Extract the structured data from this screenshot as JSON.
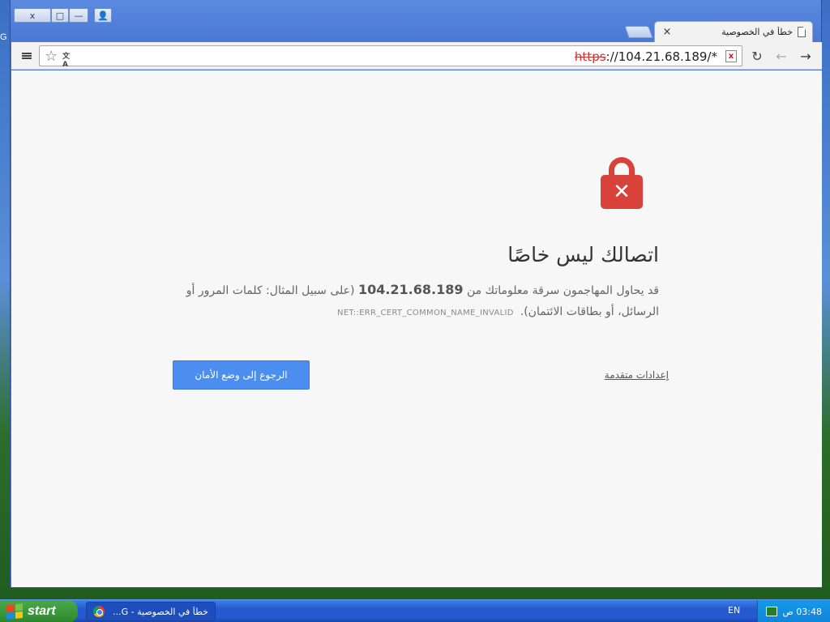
{
  "desktop": {
    "edge_letter": "G"
  },
  "window": {
    "buttons": {
      "close": "x",
      "maximize": "□",
      "minimize": "—",
      "user": "👤"
    }
  },
  "tab": {
    "title": "خطأ في الخصوصية",
    "close": "×"
  },
  "toolbar": {
    "url_scheme": "https",
    "url_rest": "://104.21.68.189/*",
    "cert_icon": "x"
  },
  "interstitial": {
    "heading": "اتصالك ليس خاصًا",
    "body_before": "قد يحاول المهاجمون سرقة معلوماتك من ",
    "host": "104.21.68.189",
    "body_after": " (على سبيل المثال: كلمات المرور أو الرسائل، أو بطاقات الائتمان).",
    "error_code": "NET::ERR_CERT_COMMON_NAME_INVALID",
    "back_button": "الرجوع إلى وضع الأمان",
    "advanced_link": "إعدادات متقدمة"
  },
  "colors": {
    "lock": "#d9423b",
    "primary_button": "#4b8ef0",
    "url_scheme_error": "#cc3333"
  },
  "taskbar": {
    "start_label": "start",
    "task_label": "خطأ في الخصوصية - G...",
    "language": "EN",
    "clock": "03:48 ص"
  }
}
